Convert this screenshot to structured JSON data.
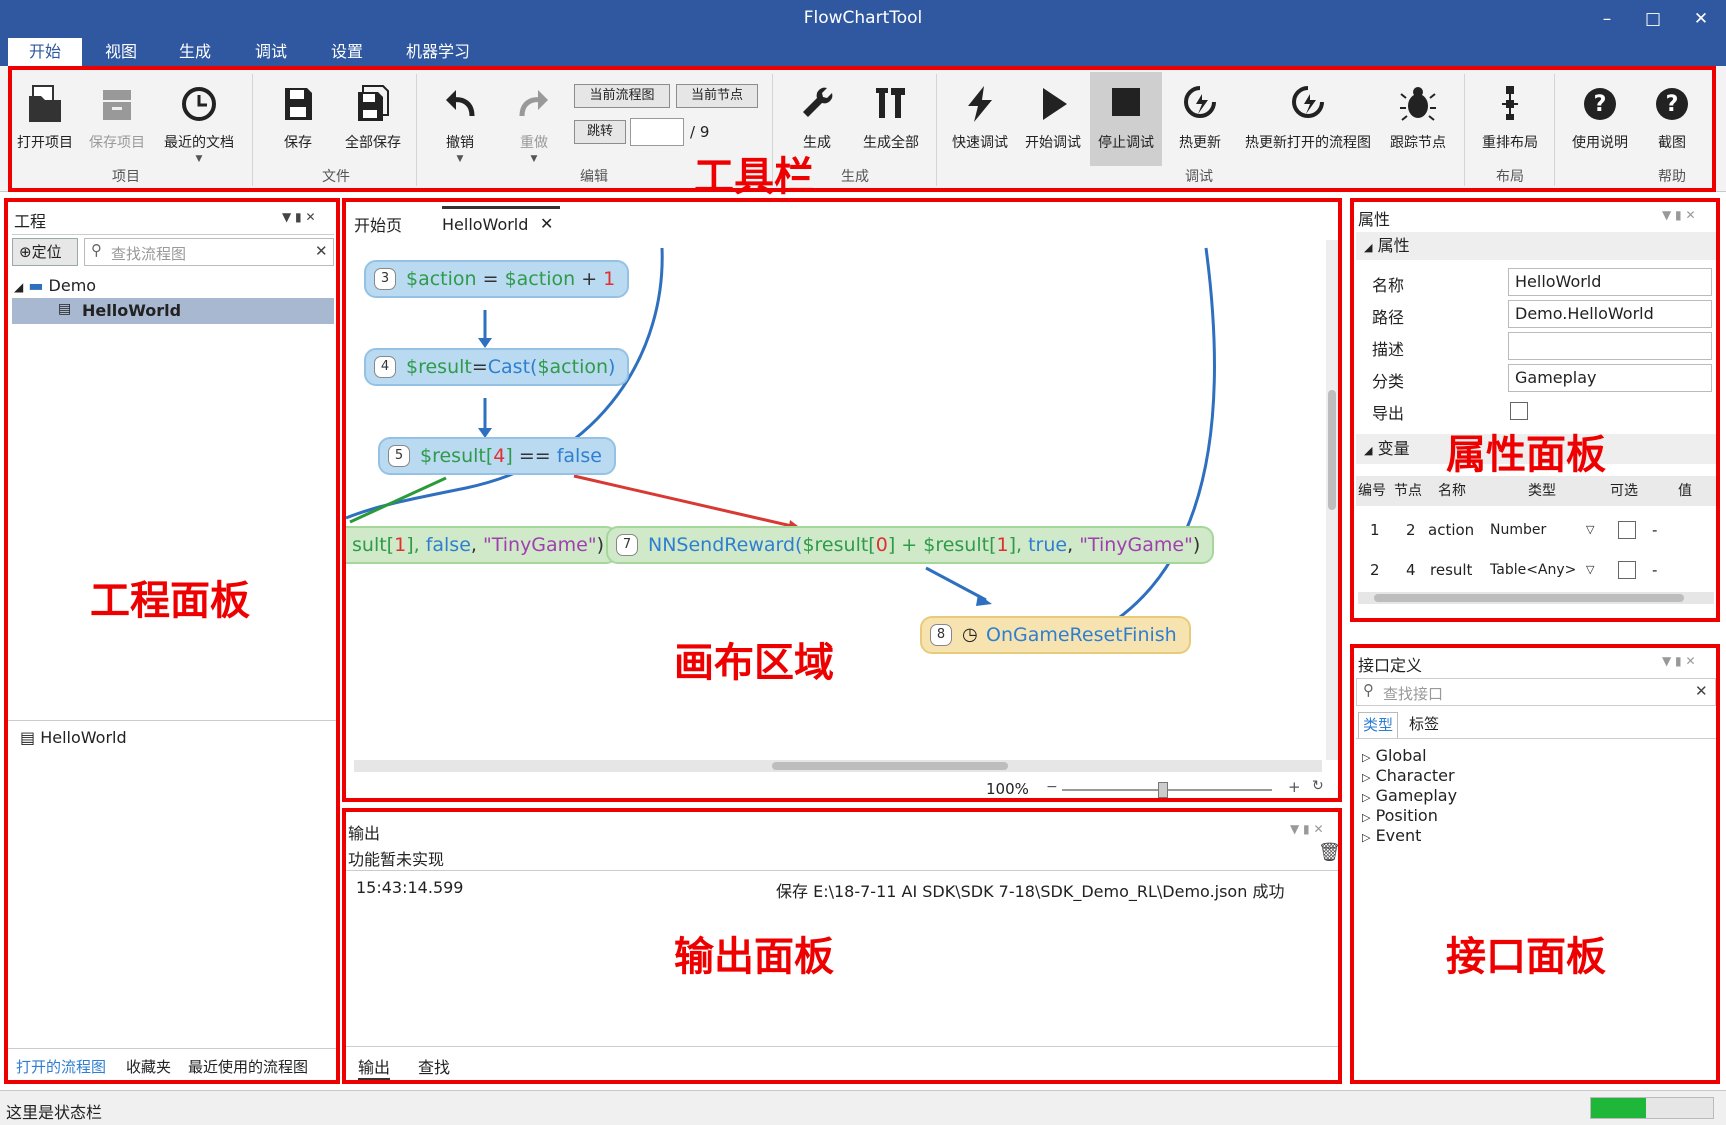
{
  "window": {
    "title": "FlowChartTool",
    "minimize": "–",
    "maximize": "□",
    "close": "✕"
  },
  "menu": [
    "开始",
    "视图",
    "生成",
    "调试",
    "设置",
    "机器学习"
  ],
  "ribbon": {
    "project": {
      "open": "打开项目",
      "save": "保存项目",
      "recent": "最近的文档",
      "group": "项目"
    },
    "file": {
      "save": "保存",
      "save_all": "全部保存",
      "group": "文件"
    },
    "edit": {
      "undo": "撤销",
      "redo": "重做",
      "current_flow": "当前流程图",
      "current_node": "当前节点",
      "jump": "跳转",
      "page_total": "/ 9",
      "group": "编辑"
    },
    "build": {
      "build": "生成",
      "build_all": "生成全部",
      "group": "生成"
    },
    "debug": {
      "quick": "快速调试",
      "start": "开始调试",
      "stop": "停止调试",
      "hot": "热更新",
      "hot_open": "热更新打开的流程图",
      "trace": "跟踪节点",
      "group": "调试"
    },
    "layout": {
      "relayout": "重排布局",
      "group": "布局"
    },
    "help": {
      "manual": "使用说明",
      "screenshot": "截图",
      "group": "帮助"
    }
  },
  "project_panel": {
    "title": "工程",
    "locate": "定位",
    "search_placeholder": "查找流程图",
    "tree": {
      "folder": "Demo",
      "file": "HelloWorld"
    },
    "open_item": "HelloWorld",
    "tabs": [
      "打开的流程图",
      "收藏夹",
      "最近使用的流程图"
    ]
  },
  "canvas": {
    "tabs": [
      "开始页",
      "HelloWorld"
    ],
    "zoom": "100%"
  },
  "nodes": {
    "n3": {
      "num": "3",
      "t1": "$action",
      "t2": " = ",
      "t3": "$action",
      "t4": " + ",
      "t5": "1"
    },
    "n4": {
      "num": "4",
      "t1": "$result",
      "t2": "=",
      "t3": "Cast(",
      "t4": "$action",
      "t5": ")"
    },
    "n5": {
      "num": "5",
      "t1": "$result[",
      "t2": "4",
      "t3": "]",
      "t4": " == ",
      "t5": "false"
    },
    "n6": {
      "t1": "sult[",
      "t2": "1",
      "t3": "], ",
      "t4": "false",
      "t5": ", ",
      "t6": "\"TinyGame\"",
      "t7": ")"
    },
    "n7": {
      "num": "7",
      "t1": "NNSendReward(",
      "t2": "$result[",
      "t3": "0",
      "t4": "] + ",
      "t5": "$result[",
      "t6": "1",
      "t7": "], ",
      "t8": "true",
      "t9": ", ",
      "t10": "\"TinyGame\"",
      "t11": ")"
    },
    "n8": {
      "num": "8",
      "t1": "OnGameResetFinish"
    }
  },
  "properties": {
    "title": "属性",
    "section": "属性",
    "labels": [
      "名称",
      "路径",
      "描述",
      "分类",
      "导出"
    ],
    "values": [
      "HelloWorld",
      "Demo.HelloWorld",
      "",
      "Gameplay",
      ""
    ],
    "var_section": "变量",
    "var_headers": [
      "编号",
      "节点",
      "名称",
      "类型",
      "可选",
      "值"
    ],
    "vars": [
      {
        "no": "1",
        "node": "2",
        "name": "action",
        "type": "Number",
        "val": "-"
      },
      {
        "no": "2",
        "node": "4",
        "name": "result",
        "type": "Table<Any>",
        "val": "-"
      }
    ]
  },
  "interface_panel": {
    "title": "接口定义",
    "search_placeholder": "查找接口",
    "tabs": [
      "类型",
      "标签"
    ],
    "items": [
      "Global",
      "Character",
      "Gameplay",
      "Position",
      "Event"
    ]
  },
  "output": {
    "title": "输出",
    "notice": "功能暂未实现",
    "time": "15:43:14.599",
    "message": "保存 E:\\18-7-11 AI SDK\\SDK 7-18\\SDK_Demo_RL\\Demo.json 成功",
    "tabs": [
      "输出",
      "查找"
    ]
  },
  "status": {
    "text": "这里是状态栏",
    "progress": 0.45
  },
  "annotations": {
    "toolbar": "工具栏",
    "project": "工程面板",
    "canvas": "画布区域",
    "props": "属性面板",
    "output": "输出面板",
    "iface": "接口面板"
  },
  "colors": {
    "title_bg": "#2f58a0",
    "highlight": "#e00000",
    "accent": "#2f7fd0",
    "progress": "#1fb73a"
  }
}
